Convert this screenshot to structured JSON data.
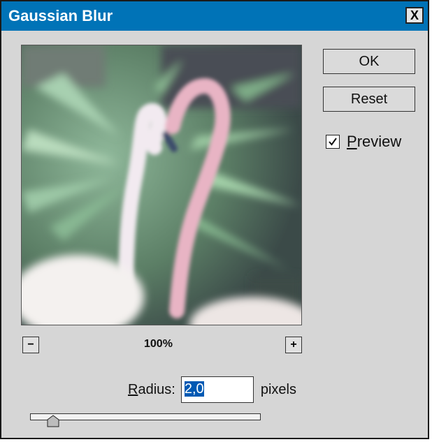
{
  "window": {
    "title": "Gaussian Blur",
    "close_label": "X"
  },
  "buttons": {
    "ok_label": "OK",
    "reset_label": "Reset"
  },
  "preview_option": {
    "label_underlined": "P",
    "label_rest": "review",
    "checked": true
  },
  "zoom": {
    "minus_label": "−",
    "plus_label": "+",
    "level": "100%"
  },
  "radius": {
    "label_underlined": "R",
    "label_rest": "adius:",
    "value": "2,0",
    "unit": "pixels",
    "slider_fraction": 0.1
  },
  "colors": {
    "titlebar": "#0073b7",
    "dialog_bg": "#d6d6d6",
    "selection": "#0059b3"
  },
  "icons": {
    "close": "close-icon",
    "check": "checkmark-icon",
    "minus": "minus-icon",
    "plus": "plus-icon"
  }
}
